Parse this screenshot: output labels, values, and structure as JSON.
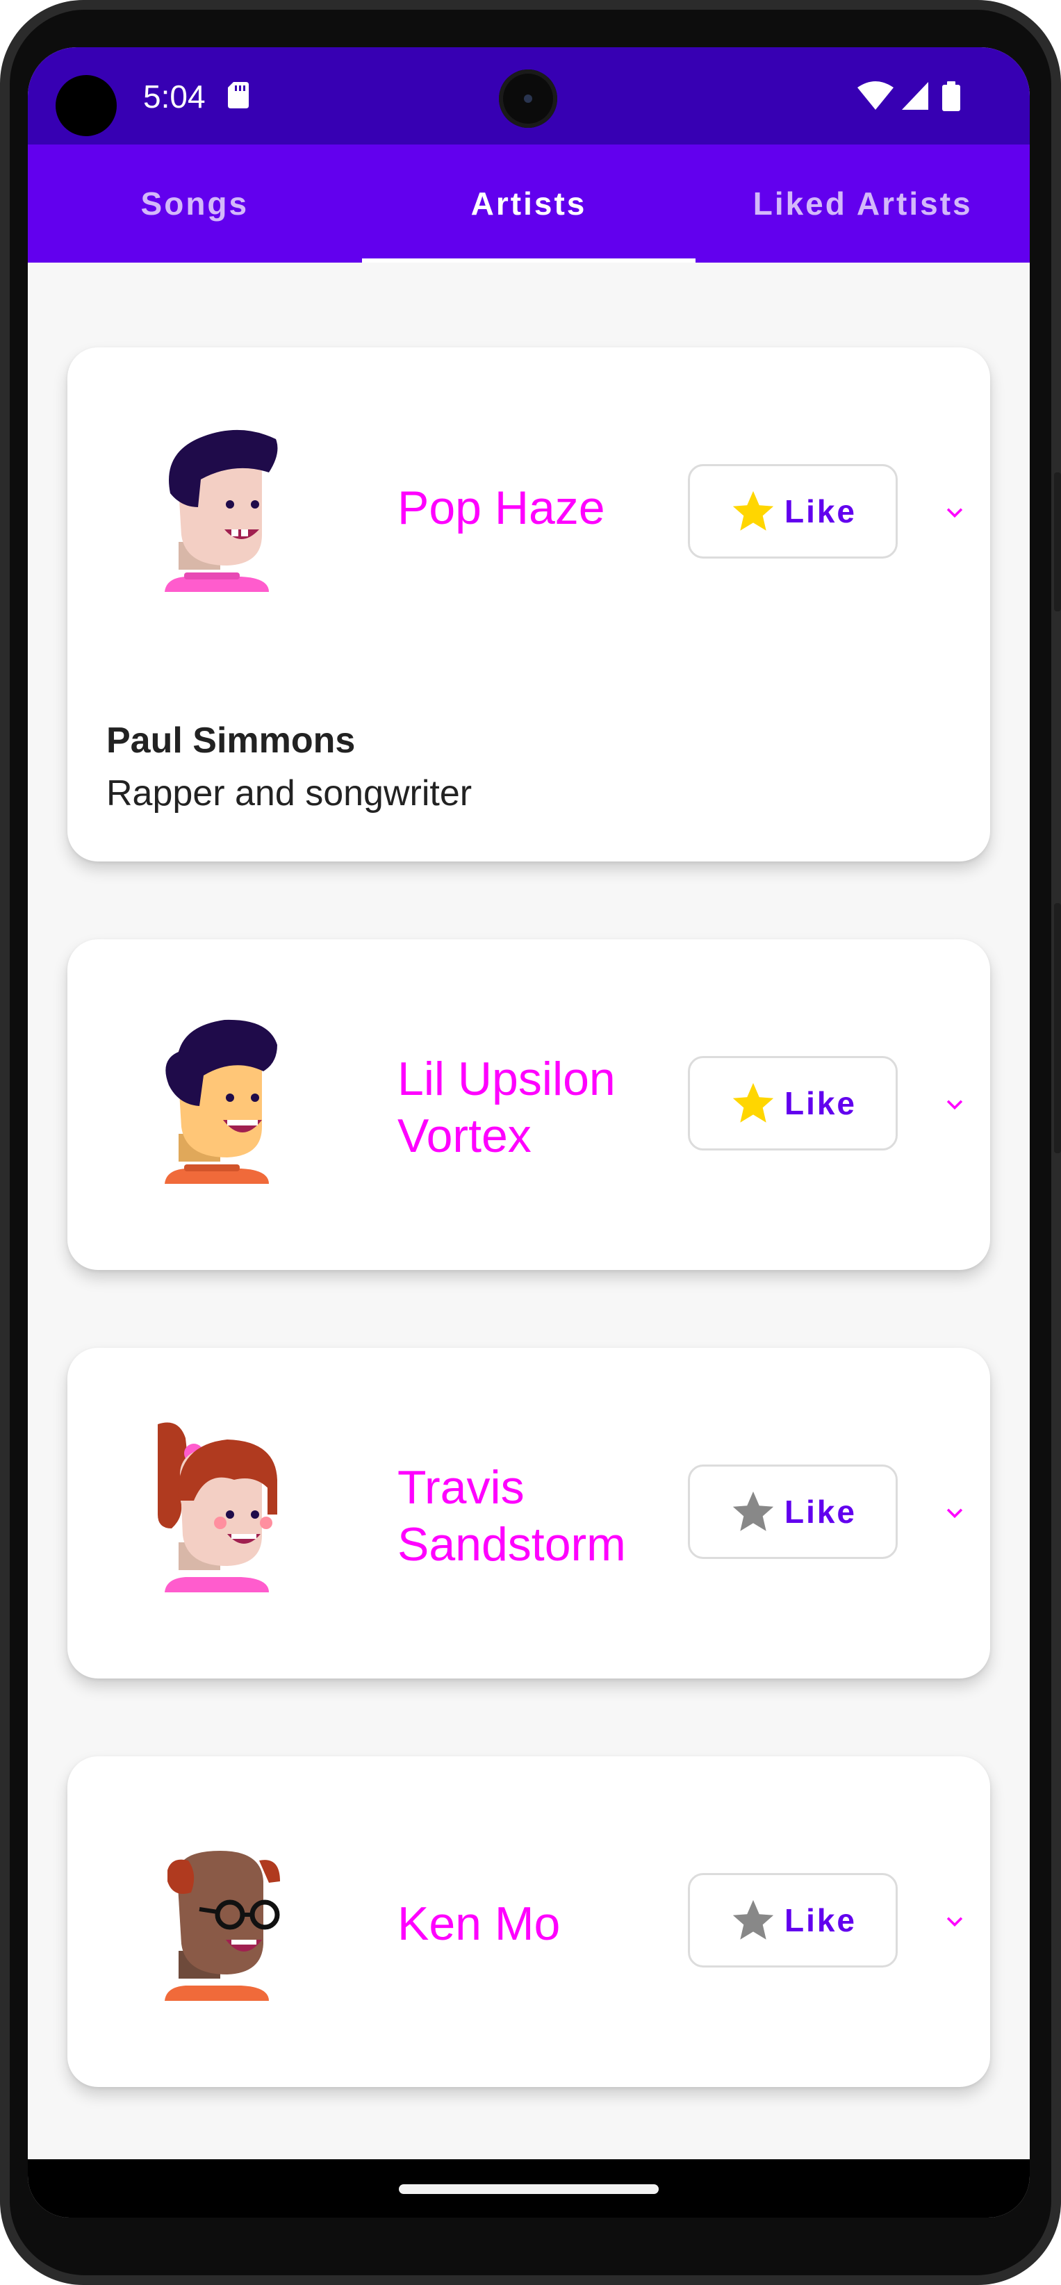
{
  "status_bar": {
    "time": "5:04"
  },
  "tabs": [
    {
      "label": "Songs"
    },
    {
      "label": "Artists"
    },
    {
      "label": "Liked Artists"
    }
  ],
  "active_tab": "Artists",
  "colors": {
    "primary": "#6200ee",
    "status_bar": "#3700b3",
    "accent_name": "#ff00ff",
    "star_liked": "#ffd600",
    "star_unliked": "#888888"
  },
  "artists": [
    {
      "name": "Pop Haze",
      "like_label": "Like",
      "liked": true,
      "expanded": true,
      "detail_title": "Paul Simmons",
      "detail_subtitle": "Rapper and songwriter",
      "avatar_icon": "avatar-male-dark-hair-icon",
      "chevron_icon": "chevron-down-icon"
    },
    {
      "name": "Lil Upsilon Vortex",
      "like_label": "Like",
      "liked": true,
      "expanded": false,
      "avatar_icon": "avatar-male-orange-skin-icon",
      "chevron_icon": "chevron-down-icon"
    },
    {
      "name": "Travis Sandstorm",
      "like_label": "Like",
      "liked": false,
      "expanded": false,
      "avatar_icon": "avatar-female-red-hair-icon",
      "chevron_icon": "chevron-down-icon"
    },
    {
      "name": "Ken Mo",
      "like_label": "Like",
      "liked": false,
      "expanded": false,
      "avatar_icon": "avatar-male-glasses-icon",
      "chevron_icon": "chevron-down-icon"
    }
  ]
}
